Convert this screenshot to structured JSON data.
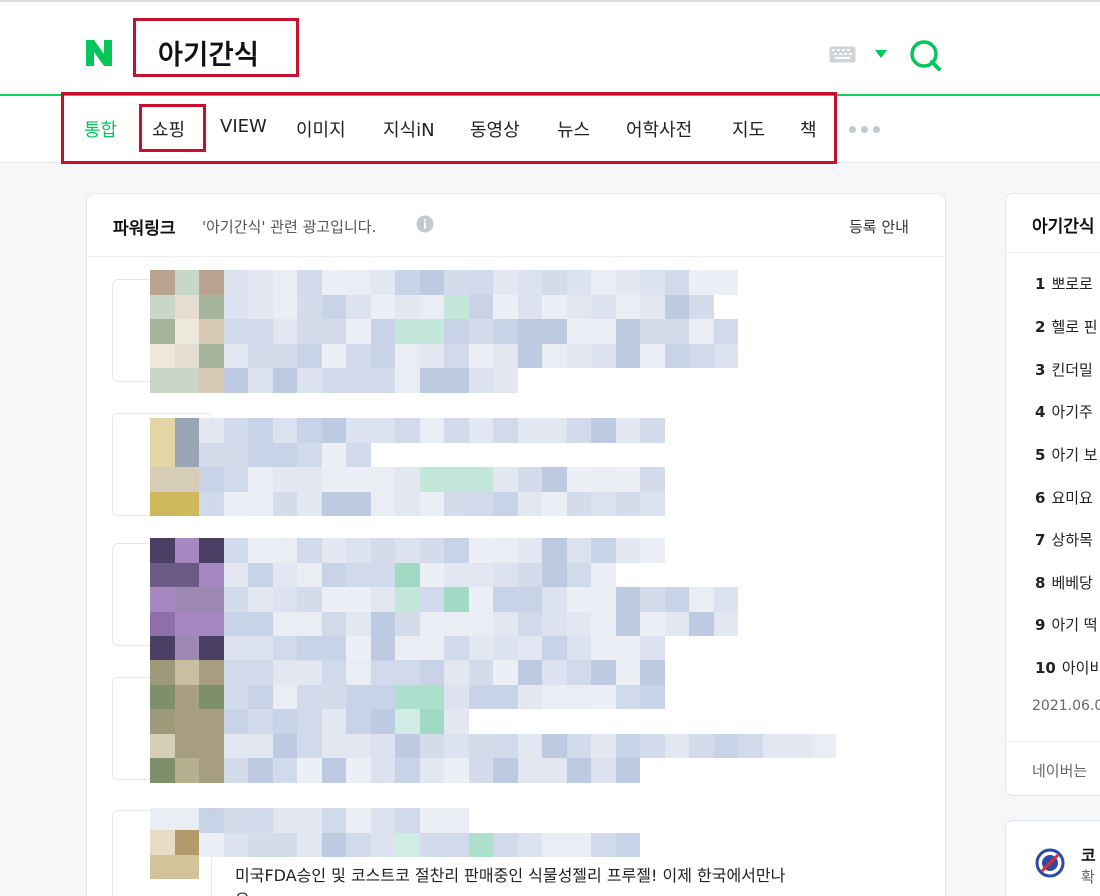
{
  "search": {
    "query": "아기간식"
  },
  "tabs": [
    {
      "label": "통합",
      "active": true
    },
    {
      "label": "쇼핑",
      "active": false
    },
    {
      "label": "VIEW",
      "active": false
    },
    {
      "label": "이미지",
      "active": false
    },
    {
      "label": "지식iN",
      "active": false
    },
    {
      "label": "동영상",
      "active": false
    },
    {
      "label": "뉴스",
      "active": false
    },
    {
      "label": "어학사전",
      "active": false
    },
    {
      "label": "지도",
      "active": false
    },
    {
      "label": "책",
      "active": false
    }
  ],
  "powerlink": {
    "title": "파워링크",
    "description": "'아기간식' 관련 광고입니다.",
    "register_label": "등록 안내",
    "ad_snippet": "미국FDA승인 및 코스트코 절찬리 판매중인 식물성젤리 프루젤! 이제 한국에서만나",
    "ad_snippet_cont": "요"
  },
  "related": {
    "title": "아기간식",
    "items": [
      {
        "rank": "1",
        "text": "뽀로로"
      },
      {
        "rank": "2",
        "text": "헬로 핀"
      },
      {
        "rank": "3",
        "text": "킨더밀"
      },
      {
        "rank": "4",
        "text": "아기주"
      },
      {
        "rank": "5",
        "text": "아기 보"
      },
      {
        "rank": "6",
        "text": "요미요"
      },
      {
        "rank": "7",
        "text": "상하목"
      },
      {
        "rank": "8",
        "text": "베베당"
      },
      {
        "rank": "9",
        "text": "아기 떡"
      },
      {
        "rank": "10",
        "text": "아이비"
      }
    ],
    "date": "2021.06.0",
    "footer": "네이버는"
  },
  "side_card": {
    "title": "코",
    "subtitle": "확"
  },
  "colors": {
    "brand_green": "#03c75a",
    "highlight_red": "#c8102e"
  },
  "icons": [
    "naver-logo-icon",
    "keyboard-icon",
    "chevron-down-icon",
    "search-icon",
    "info-icon",
    "more-icon",
    "covid-icon"
  ]
}
